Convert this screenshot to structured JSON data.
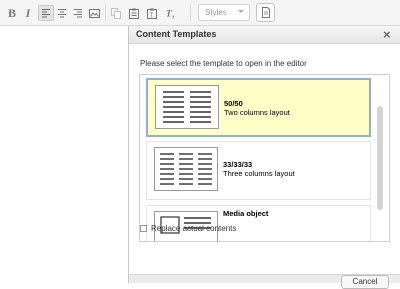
{
  "toolbar": {
    "bold_label": "B",
    "italic_label": "I",
    "styles_label": "Styles"
  },
  "dialog": {
    "title": "Content Templates",
    "close_label": "×",
    "instruction": "Please select the template to open in the editor",
    "templates": [
      {
        "title": "50/50",
        "description": "Two columns layout",
        "selected": true
      },
      {
        "title": "33/33/33",
        "description": "Three columns layout",
        "selected": false
      },
      {
        "title": "Media object",
        "description": "",
        "selected": false
      }
    ],
    "replace_label": "Replace actual contents",
    "cancel_label": "Cancel"
  }
}
